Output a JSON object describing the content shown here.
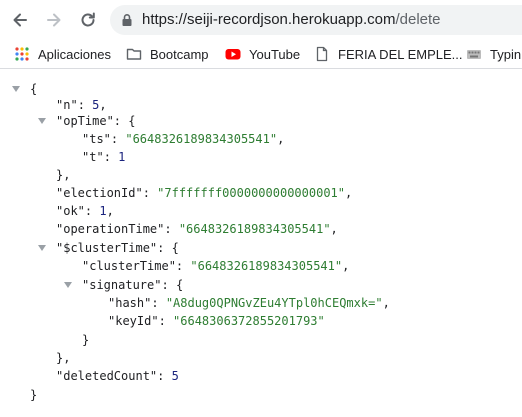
{
  "browser": {
    "url_host": "https://seiji-recordjson.herokuapp.com",
    "url_path": "/delete"
  },
  "bookmarks": [
    {
      "label": "Aplicaciones",
      "icon": "apps-grid-icon"
    },
    {
      "label": "Bootcamp",
      "icon": "folder-icon"
    },
    {
      "label": "YouTube",
      "icon": "youtube-icon"
    },
    {
      "label": "FERIA DEL EMPLE...",
      "icon": "page-icon"
    },
    {
      "label": "Typin",
      "icon": "typing-icon"
    }
  ],
  "json": {
    "open_brace": "{",
    "n_key": "\"n\"",
    "n_val": "5",
    "opTime_key": "\"opTime\"",
    "opTime_open": "{",
    "ts_key": "\"ts\"",
    "ts_val": "\"6648326189834305541\"",
    "t_key": "\"t\"",
    "t_val": "1",
    "opTime_close": "},",
    "electionId_key": "\"electionId\"",
    "electionId_val": "\"7fffffff0000000000000001\"",
    "ok_key": "\"ok\"",
    "ok_val": "1",
    "operationTime_key": "\"operationTime\"",
    "operationTime_val": "\"6648326189834305541\"",
    "clusterTime_key": "\"$clusterTime\"",
    "clusterTime_open": "{",
    "inner_clusterTime_key": "\"clusterTime\"",
    "inner_clusterTime_val": "\"6648326189834305541\"",
    "signature_key": "\"signature\"",
    "signature_open": "{",
    "hash_key": "\"hash\"",
    "hash_val": "\"A8dug0QPNGvZEu4YTpl0hCEQmxk=\"",
    "keyId_key": "\"keyId\"",
    "keyId_val": "\"6648306372855201793\"",
    "signature_close": "}",
    "clusterTime_close": "},",
    "deletedCount_key": "\"deletedCount\"",
    "deletedCount_val": "5",
    "close_brace": "}"
  }
}
